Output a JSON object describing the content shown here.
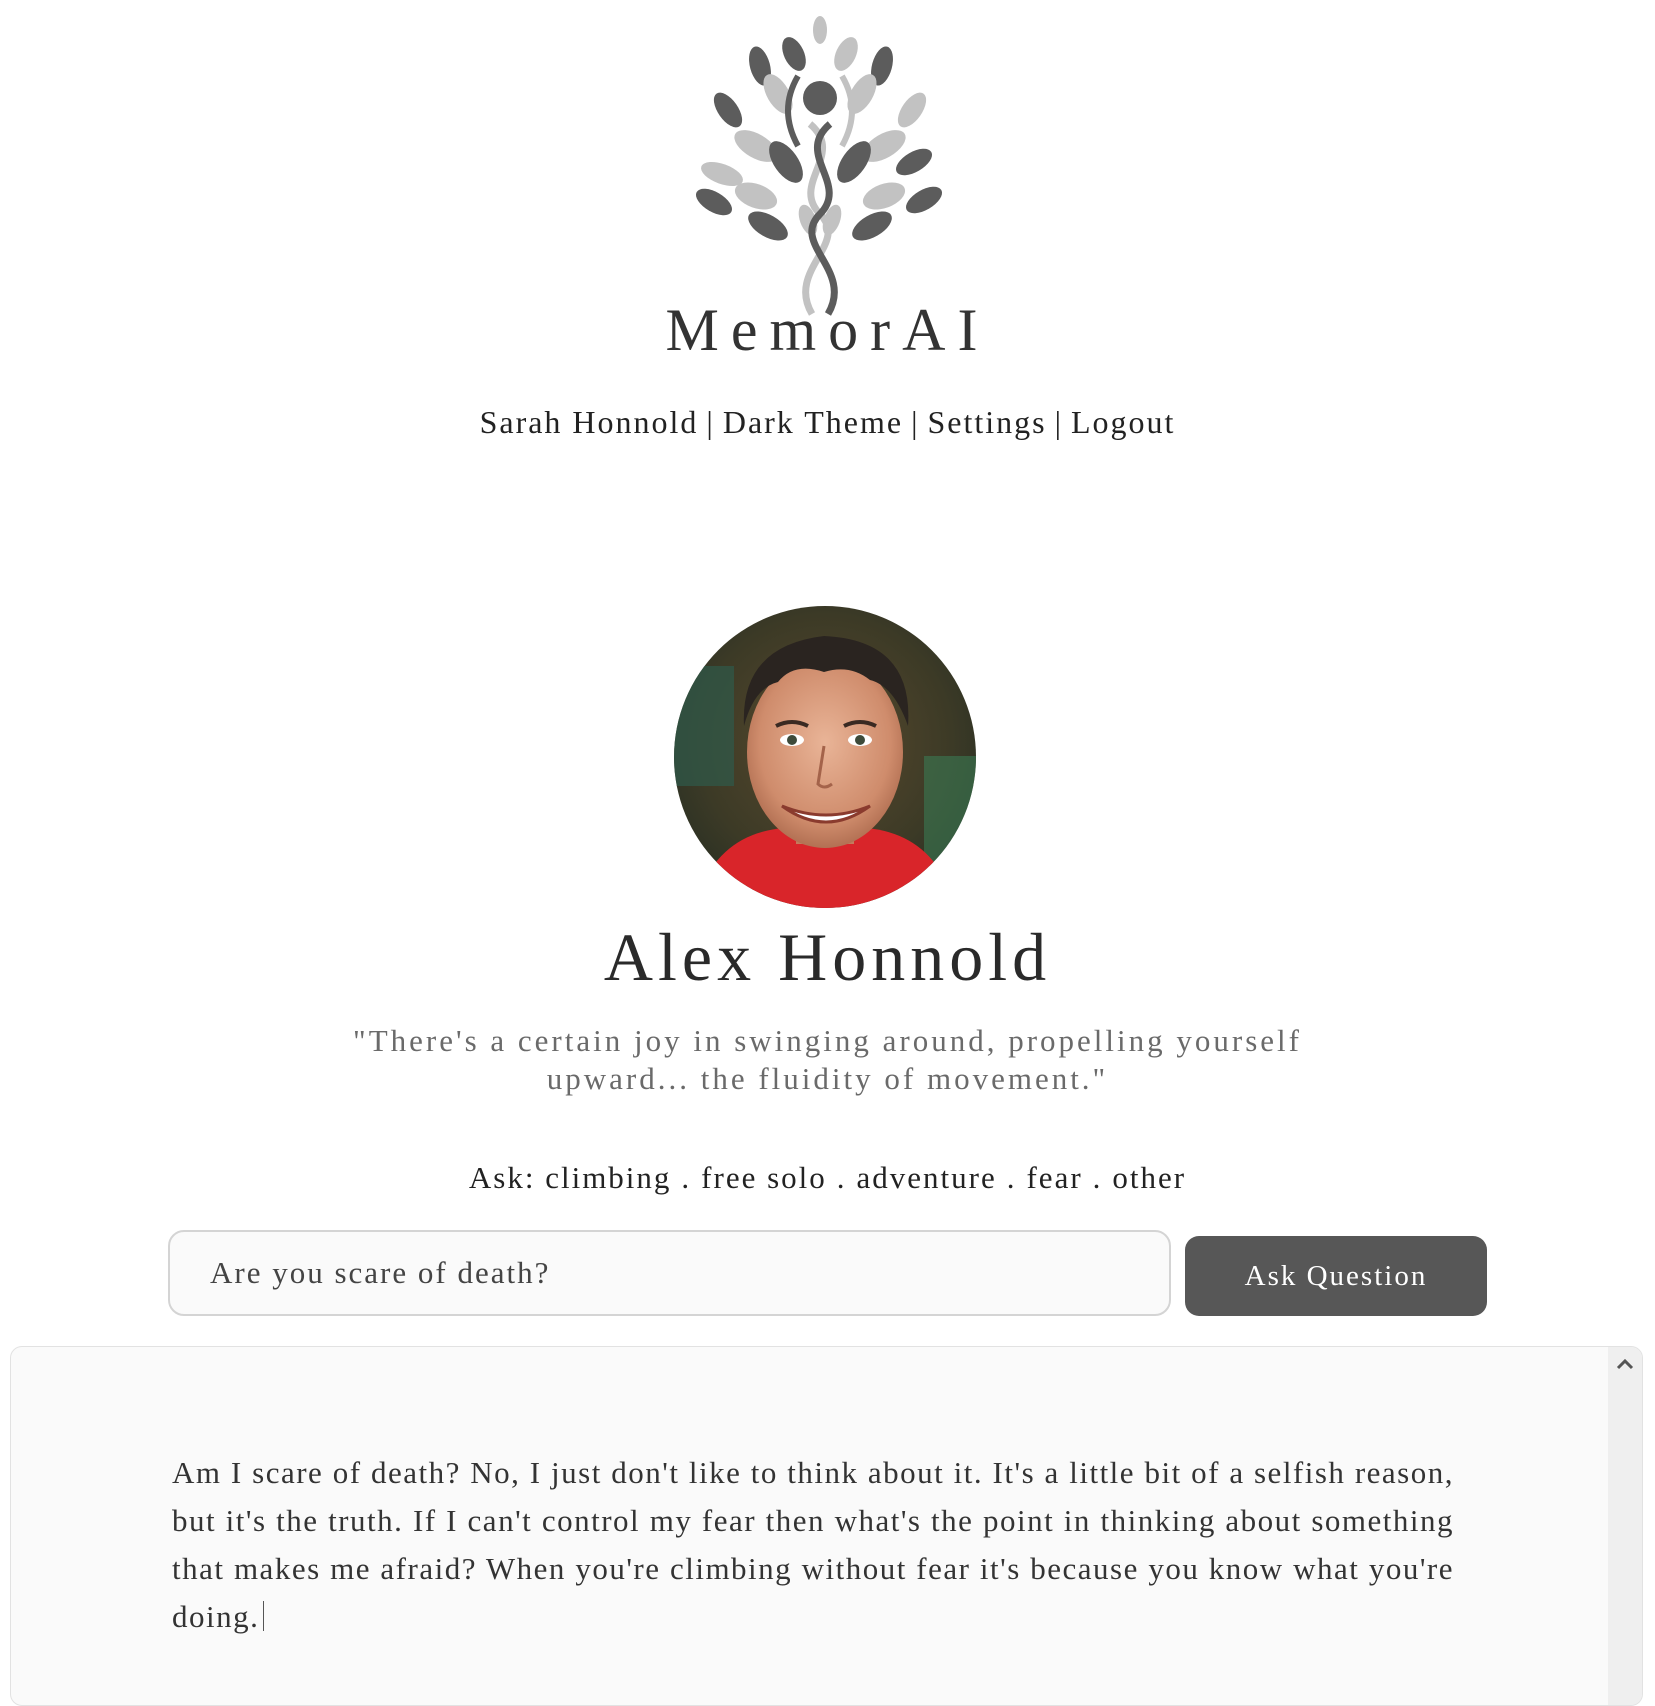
{
  "app": {
    "brand_name": "MemorAI"
  },
  "nav": {
    "user_label": "Sarah Honnold",
    "theme_label": "Dark Theme",
    "settings_label": "Settings",
    "logout_label": "Logout",
    "separator": "|"
  },
  "profile": {
    "name": "Alex Honnold",
    "quote_line1": "\"There's a certain joy in swinging around, propelling yourself",
    "quote_line2": "upward... the fluidity of movement.\""
  },
  "topics": {
    "prefix": "Ask:",
    "separator": ".",
    "items": [
      "climbing",
      "free solo",
      "adventure",
      "fear",
      "other"
    ]
  },
  "ask": {
    "input_value": "Are you scare of death?",
    "button_label": "Ask Question"
  },
  "answer": {
    "text": "Am I scare of death? No, I just don't like to think about it. It's a little bit of a selfish reason, but it's the truth. If I can't control my fear then what's the point in thinking about something that makes me afraid? When you're climbing without fear it's because you know what you're doing."
  },
  "colors": {
    "logo_dark": "#5c5c5c",
    "logo_light": "#c2c2c2",
    "button_bg": "#575757",
    "panel_bg": "#fafafa",
    "quote_text": "#6a6a6a"
  },
  "icons": {
    "logo": "tree-logo-icon",
    "scroll_up": "chevron-up-icon"
  }
}
